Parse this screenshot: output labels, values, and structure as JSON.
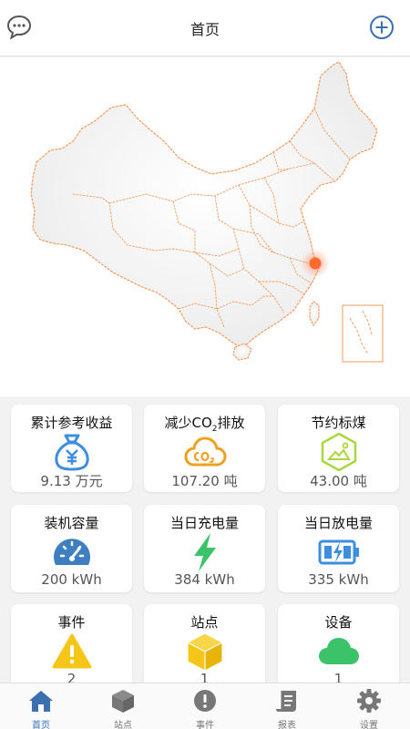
{
  "header": {
    "title": "首页",
    "left_icon": "chat-bubble-icon",
    "right_icon": "add-circle-icon"
  },
  "map": {
    "marker_color": "#ff6a2e",
    "border_color": "#f39a5c"
  },
  "cards": [
    {
      "label": "累计参考收益",
      "value": "9.13 万元",
      "icon": "money-bag-icon",
      "color": "#3d8ee0"
    },
    {
      "label_pre": "减少",
      "label_co": "CO",
      "label_sub": "2",
      "label_post": "排放",
      "value": "107.20 吨",
      "icon": "co2-cloud-icon",
      "color": "#f0a020"
    },
    {
      "label": "节约标煤",
      "value": "43.00 吨",
      "icon": "coal-hexagon-icon",
      "color": "#a8d83a"
    },
    {
      "label": "装机容量",
      "value": "200 kWh",
      "icon": "gauge-icon",
      "color": "#3d7fc0"
    },
    {
      "label": "当日充电量",
      "value": "384 kWh",
      "icon": "lightning-icon",
      "color": "#3cc36a"
    },
    {
      "label": "当日放电量",
      "value": "335 kWh",
      "icon": "battery-charging-icon",
      "color": "#3d8ee0"
    },
    {
      "label": "事件",
      "value": "2",
      "icon": "warning-icon",
      "color": "#f5c518"
    },
    {
      "label": "站点",
      "value": "1",
      "icon": "cube-icon",
      "color": "#f5c518"
    },
    {
      "label": "设备",
      "value": "1",
      "icon": "cloud-icon",
      "color": "#3cc36a"
    }
  ],
  "tabs": [
    {
      "label": "首页",
      "icon": "home-icon",
      "active": true
    },
    {
      "label": "站点",
      "icon": "cube-icon"
    },
    {
      "label": "事件",
      "icon": "alert-circle-icon"
    },
    {
      "label": "报表",
      "icon": "report-icon"
    },
    {
      "label": "设置",
      "icon": "gear-icon"
    }
  ],
  "colors": {
    "accent": "#3a6fb0",
    "tab_inactive": "#777777"
  }
}
